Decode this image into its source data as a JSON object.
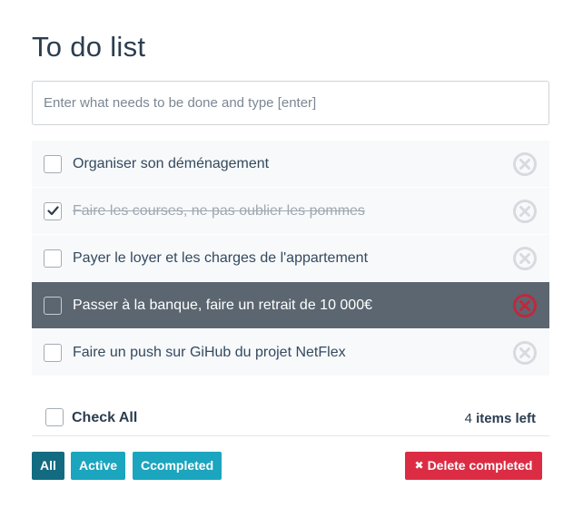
{
  "header": {
    "title": "To do list"
  },
  "new_todo": {
    "placeholder": "Enter what needs to be done and type [enter]",
    "value": ""
  },
  "todos": [
    {
      "text": "Organiser son déménagement",
      "completed": false,
      "hovered": false
    },
    {
      "text": "Faire les courses, ne pas oublier les pommes",
      "completed": true,
      "hovered": false
    },
    {
      "text": "Payer le loyer et les charges de l'appartement",
      "completed": false,
      "hovered": false
    },
    {
      "text": "Passer à la banque, faire un retrait de 10 000€",
      "completed": false,
      "hovered": true
    },
    {
      "text": "Faire un push sur GiHub du projet NetFlex",
      "completed": false,
      "hovered": false
    }
  ],
  "footer": {
    "check_all_label": "Check All",
    "check_all_checked": false,
    "items_left_count": "4",
    "items_left_label": "items left"
  },
  "filters": [
    {
      "label": "All",
      "selected": true
    },
    {
      "label": "Active",
      "selected": false
    },
    {
      "label": "Ccompleted",
      "selected": false
    }
  ],
  "delete_completed": {
    "icon": "close-icon",
    "label": "Delete completed"
  },
  "colors": {
    "accent": "#1ba5bf",
    "accent_selected": "#126b80",
    "danger": "#dc2c44",
    "hover_row": "#5b6670",
    "row_bg": "#f7f9fb"
  }
}
